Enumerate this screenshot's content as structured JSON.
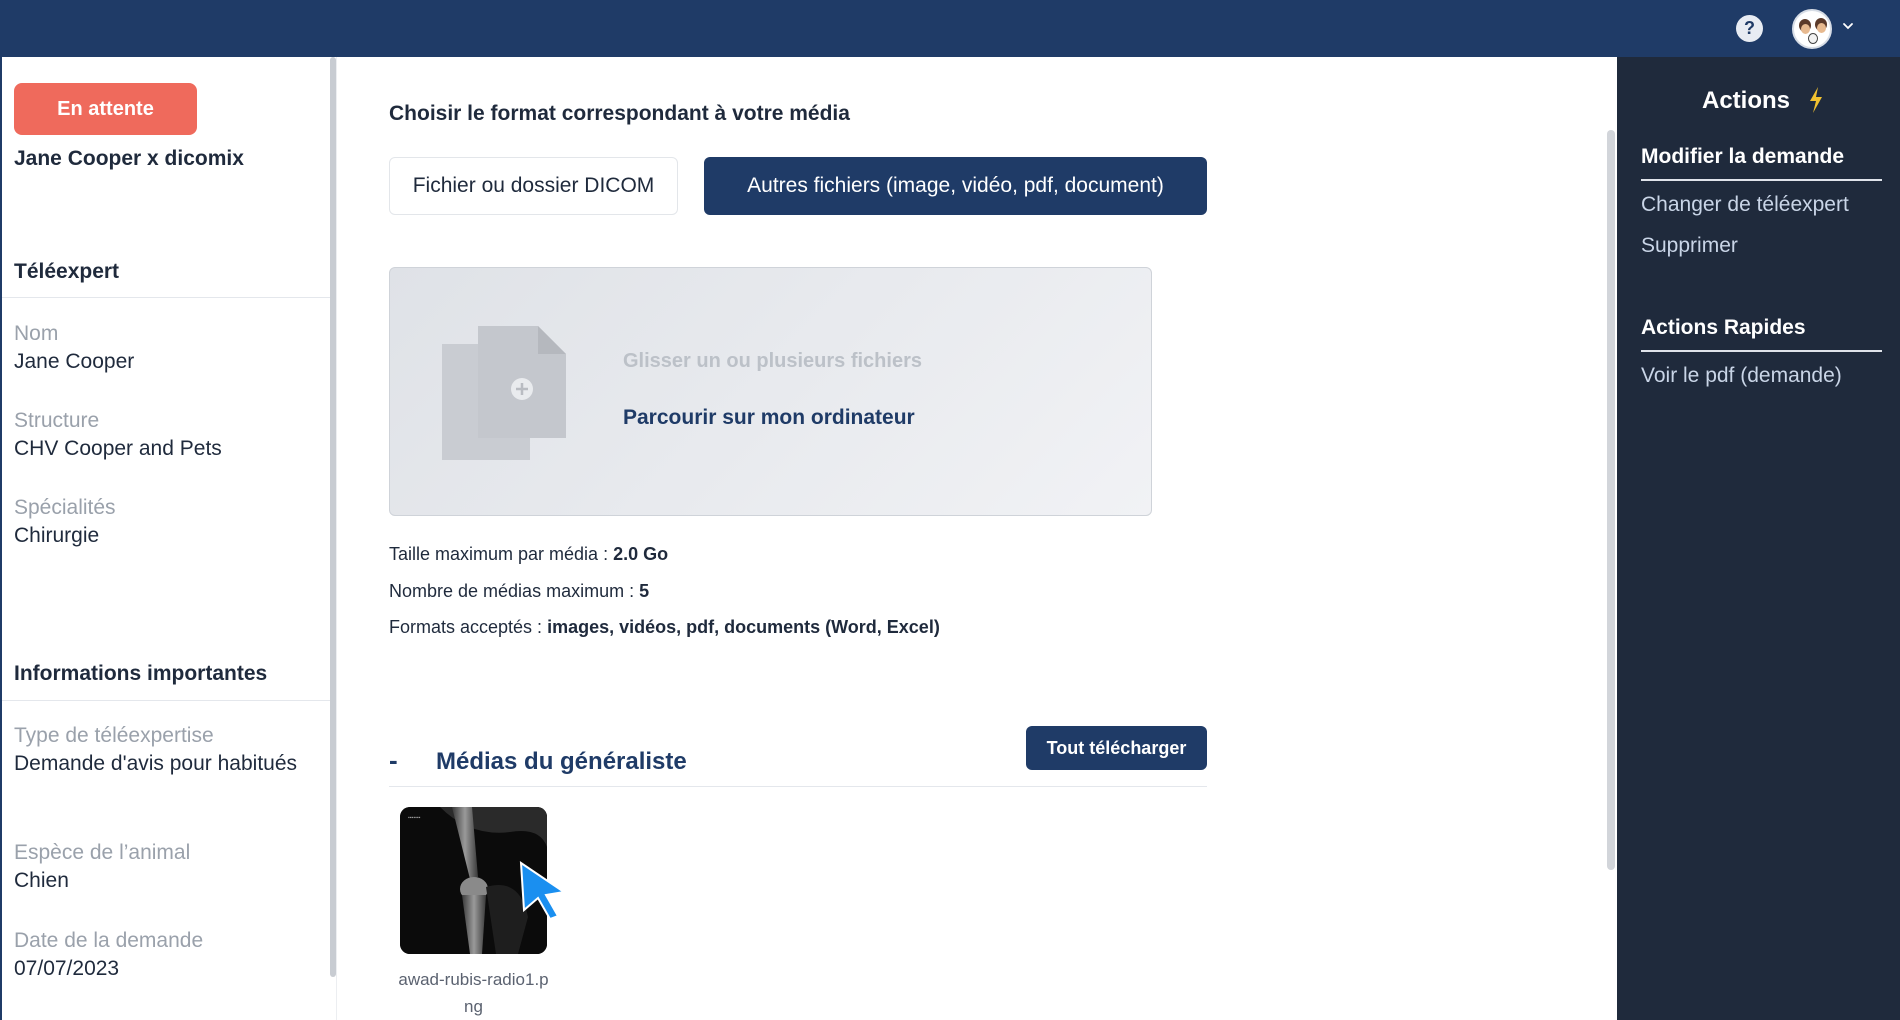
{
  "colors": {
    "brand_navy": "#1f3b67",
    "sidebar_dark": "#1f2a3c",
    "status_pending": "#ef6a5c",
    "accent_bolt": "#f2c230",
    "cursor_blue": "#1a8ff0"
  },
  "topbar": {
    "help_icon": "?",
    "avatar_icon": "avatar-icon"
  },
  "left": {
    "status": "En attente",
    "request_title": "Jane Cooper x dicomix",
    "teleexpert": {
      "title": "Téléexpert",
      "fields": [
        {
          "label": "Nom",
          "value": "Jane Cooper"
        },
        {
          "label": "Structure",
          "value": "CHV Cooper and Pets"
        },
        {
          "label": "Spécialités",
          "value": "Chirurgie"
        }
      ]
    },
    "important": {
      "title": "Informations importantes",
      "fields": [
        {
          "label": "Type de téléexpertise",
          "value": "Demande d'avis pour habitués"
        },
        {
          "label": "Espèce de l’animal",
          "value": "Chien"
        },
        {
          "label": "Date de la demande",
          "value": "07/07/2023"
        }
      ]
    }
  },
  "main": {
    "format_title": "Choisir le format correspondant à votre média",
    "format_options": [
      "Fichier ou dossier DICOM",
      "Autres fichiers (image, vidéo, pdf, document)"
    ],
    "selected_format": "Autres fichiers (image, vidéo, pdf, document)",
    "dropzone": {
      "text": "Glisser un ou plusieurs fichiers",
      "browse": "Parcourir sur mon ordinateur"
    },
    "info": [
      {
        "label": "Taille maximum par média : ",
        "value": "2.0 Go"
      },
      {
        "label": "Nombre de médias maximum : ",
        "value": "5"
      },
      {
        "label": "Formats acceptés : ",
        "value": "images, vidéos, pdf, documents (Word, Excel)"
      }
    ],
    "media": {
      "toggle": "-",
      "title": "Médias du généraliste",
      "download_all": "Tout télécharger",
      "files": [
        {
          "name": "awad-rubis-radio1.png"
        }
      ]
    }
  },
  "sidebar": {
    "title": "Actions",
    "groups": [
      {
        "heading": "Modifier la demande",
        "links": [
          "Changer de téléexpert",
          "Supprimer"
        ]
      },
      {
        "heading": "Actions Rapides",
        "links": [
          "Voir le pdf (demande)"
        ]
      }
    ]
  }
}
